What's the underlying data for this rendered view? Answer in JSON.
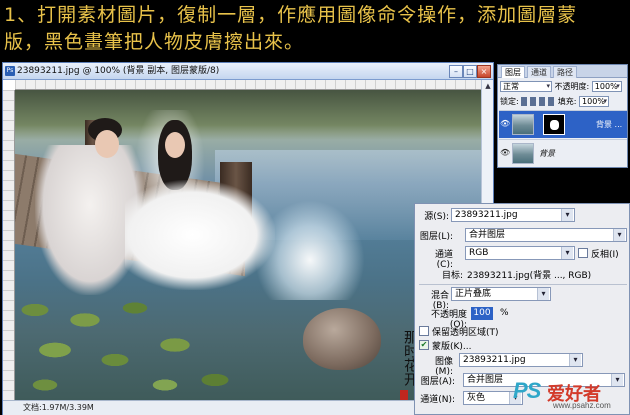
{
  "caption": {
    "line1": "1、打開素材圖片，復制一層，作應用圖像命令操作，添加圖層蒙",
    "line2": "版，黑色畫筆把人物皮膚擦出來。"
  },
  "document": {
    "title": "23893211.jpg @ 100% (背景 副本, 图层蒙版/8)",
    "status": "文档:1.97M/3.39M",
    "buttons": {
      "minimize": "–",
      "maximize": "□",
      "close": "×"
    },
    "signature": "那时花开"
  },
  "layers_panel": {
    "tabs": [
      "图层",
      "通道",
      "路径"
    ],
    "blend_mode": "正常",
    "opacity_label": "不透明度:",
    "opacity_value": "100%",
    "lock_label": "锁定:",
    "fill_label": "填充:",
    "fill_value": "100%",
    "layers": [
      {
        "name": "背景 ...",
        "has_mask": true,
        "selected": true
      },
      {
        "name": "背景",
        "has_mask": false,
        "selected": false
      }
    ]
  },
  "apply_image": {
    "source_label": "源(S):",
    "source_value": "23893211.jpg",
    "layer_label": "图层(L):",
    "layer_value": "合并图层",
    "channel_label": "通道(C):",
    "channel_value": "RGB",
    "invert_label": "反相(I)",
    "target_label": "目标:",
    "target_value": "23893211.jpg(背景 ..., RGB)",
    "blending_label": "混合(B):",
    "blending_value": "正片叠底",
    "opacity_label": "不透明度(O):",
    "opacity_value": "100",
    "opacity_unit": "%",
    "preserve_label": "保留透明区域(T)",
    "mask_label": "蒙版(K)...",
    "image_label": "图像(M):",
    "image_value": "23893211.jpg",
    "mask_layer_label": "图层(A):",
    "mask_layer_value": "合并图层",
    "mask_channel_label": "通道(N):",
    "mask_channel_value": "灰色",
    "invert_checked": false,
    "preserve_checked": false,
    "mask_checked": true
  },
  "watermark": {
    "ps": "PS",
    "text": "爱好者",
    "url": "www.psahz.com"
  }
}
